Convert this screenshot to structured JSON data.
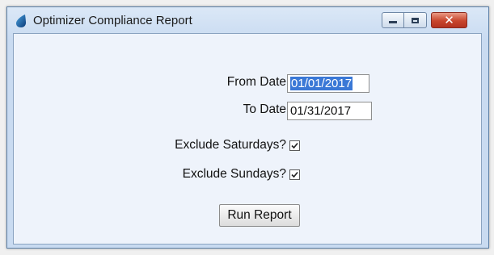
{
  "window": {
    "title": "Optimizer Compliance Report",
    "icon": "droplet-icon",
    "controls": {
      "minimize_icon": "minimize-icon",
      "maximize_icon": "maximize-icon",
      "close_icon": "close-icon",
      "close_glyph": "✕"
    }
  },
  "form": {
    "from_date": {
      "label": "From Date",
      "value": "01/01/2017",
      "selected": true
    },
    "to_date": {
      "label": "To Date",
      "value": "01/31/2017"
    },
    "exclude_saturdays": {
      "label": "Exclude Saturdays?",
      "checked": true
    },
    "exclude_sundays": {
      "label": "Exclude Sundays?",
      "checked": true
    },
    "run_button": {
      "label": "Run Report"
    }
  },
  "colors": {
    "selection": "#3a78d6",
    "close_button": "#c8452c",
    "window_frame": "#c9dbf1"
  }
}
